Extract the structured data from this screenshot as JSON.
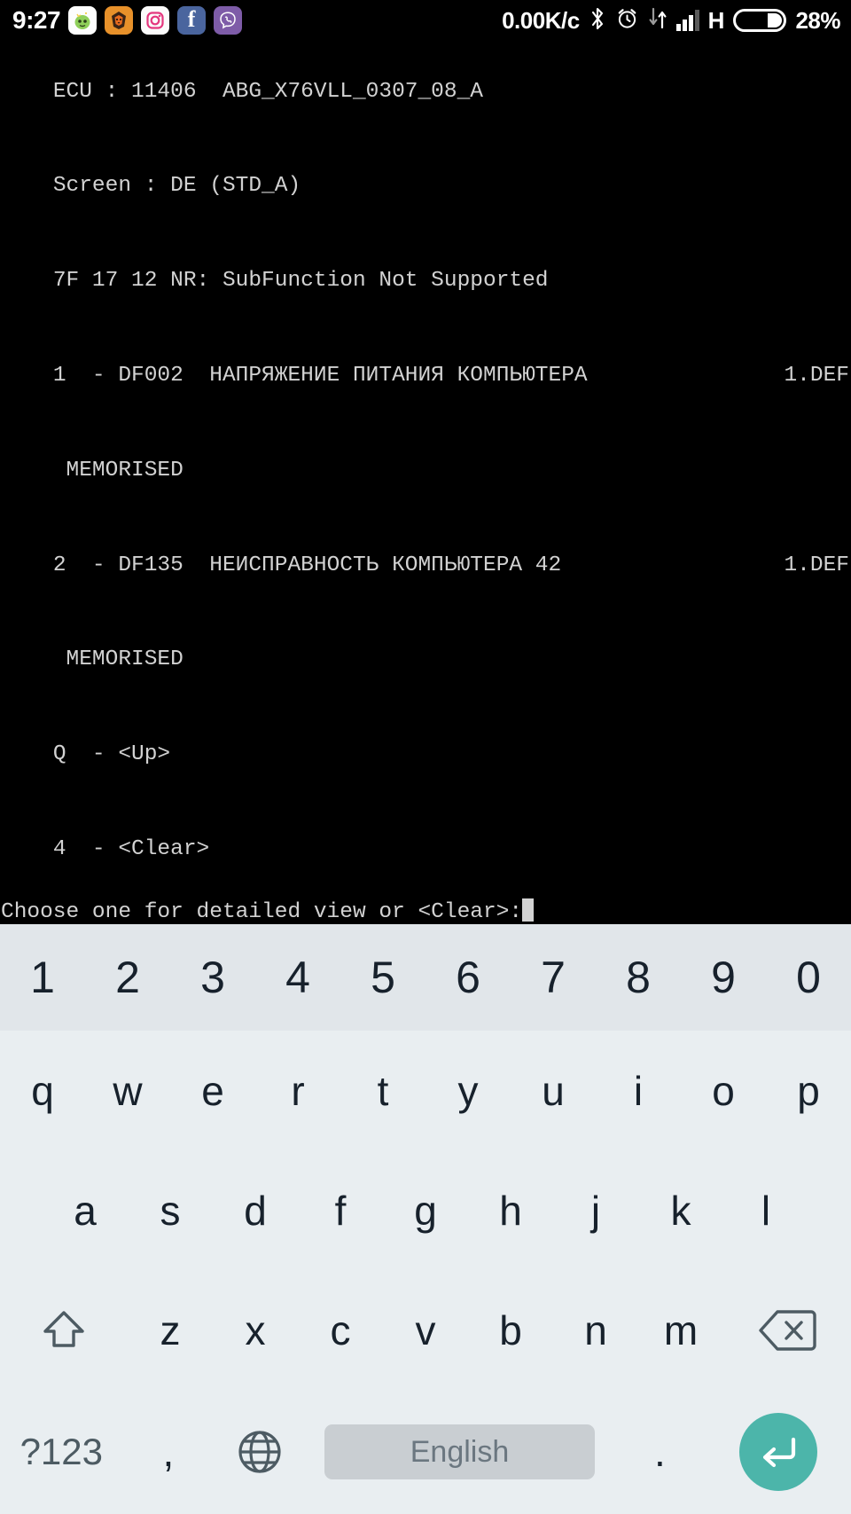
{
  "statusbar": {
    "time": "9:27",
    "app_icons": [
      "kakao-icon",
      "brave-lion-icon",
      "instagram-icon",
      "facebook-icon",
      "viber-icon"
    ],
    "facebook_glyph": "f",
    "data_rate": "0.00K/c",
    "bluetooth_icon": "bluetooth-icon",
    "alarm_icon": "alarm-clock-icon",
    "data_transfer_icon": "data-transfer-icon",
    "signal_icon": "signal-bars-icon",
    "network_type": "H",
    "battery_icon": "battery-icon",
    "battery_percent": "28%"
  },
  "terminal": {
    "lines": [
      {
        "text": "ECU : 11406  ABG_X76VLL_0307_08_A",
        "tail": ""
      },
      {
        "text": "Screen : DE (STD_A)",
        "tail": ""
      },
      {
        "text": "7F 17 12 NR: SubFunction Not Supported",
        "tail": ""
      },
      {
        "text": "1  - DF002  НАПРЯЖЕНИЕ ПИТАНИЯ КОМПЬЮТЕРА",
        "tail": "1.DEF"
      },
      {
        "text": " MEMORISED",
        "tail": ""
      },
      {
        "text": "2  - DF135  НЕИСПРАВНОСТЬ КОМПЬЮТЕРА 42",
        "tail": "1.DEF"
      },
      {
        "text": " MEMORISED",
        "tail": ""
      },
      {
        "text": "Q  - <Up>",
        "tail": ""
      },
      {
        "text": "4  - <Clear>",
        "tail": ""
      }
    ],
    "prompt": "Choose one for detailed view or <Clear>:"
  },
  "keyboard": {
    "number_row": [
      "1",
      "2",
      "3",
      "4",
      "5",
      "6",
      "7",
      "8",
      "9",
      "0"
    ],
    "row_q": [
      "q",
      "w",
      "e",
      "r",
      "t",
      "y",
      "u",
      "i",
      "o",
      "p"
    ],
    "row_a": [
      "a",
      "s",
      "d",
      "f",
      "g",
      "h",
      "j",
      "k",
      "l"
    ],
    "row_z": [
      "z",
      "x",
      "c",
      "v",
      "b",
      "n",
      "m"
    ],
    "shift_icon": "shift-icon",
    "backspace_icon": "backspace-icon",
    "symbols_label": "?123",
    "comma_label": ",",
    "globe_icon": "globe-icon",
    "space_label": "English",
    "period_label": ".",
    "enter_icon": "enter-icon",
    "colors": {
      "keyboard_bg": "#e9eef1",
      "number_row_bg": "#e1e6ea",
      "key_text": "#17212c",
      "symbol_text": "#4d5b63",
      "spacebar_bg": "#c9ced2",
      "enter_bg": "#4cb5aa",
      "terminal_text": "#d2d2d2",
      "terminal_bg": "#000000"
    }
  }
}
